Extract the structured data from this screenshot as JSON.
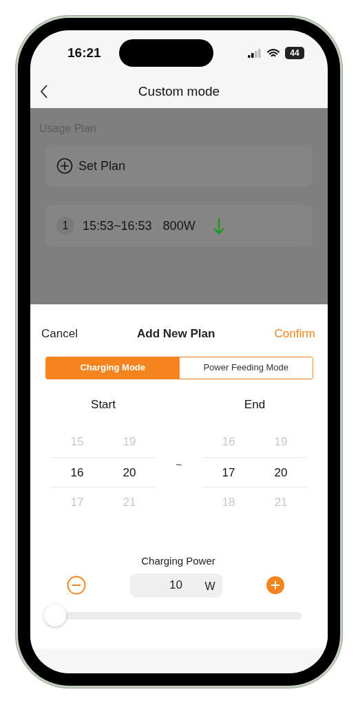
{
  "status_bar": {
    "time": "16:21",
    "battery": "44"
  },
  "nav": {
    "title": "Custom mode"
  },
  "background": {
    "section_title": "Usage Plan",
    "set_plan": "Set Plan",
    "plans": [
      {
        "index": "1",
        "time": "15:53~16:53",
        "power": "800W",
        "kind": "charging"
      }
    ]
  },
  "sheet": {
    "cancel": "Cancel",
    "title": "Add New Plan",
    "confirm": "Confirm",
    "modes": [
      {
        "label": "Charging Mode",
        "selected": true
      },
      {
        "label": "Power Feeding Mode",
        "selected": false
      }
    ],
    "separator": "~",
    "pickers": [
      {
        "label": "Start",
        "columns": [
          [
            {
              "value": "15",
              "selected": false
            },
            {
              "value": "16",
              "selected": true
            },
            {
              "value": "17",
              "selected": false
            }
          ],
          [
            {
              "value": "19",
              "selected": false
            },
            {
              "value": "20",
              "selected": true
            },
            {
              "value": "21",
              "selected": false
            }
          ]
        ]
      },
      {
        "label": "End",
        "columns": [
          [
            {
              "value": "16",
              "selected": false
            },
            {
              "value": "17",
              "selected": true
            },
            {
              "value": "18",
              "selected": false
            }
          ],
          [
            {
              "value": "19",
              "selected": false
            },
            {
              "value": "20",
              "selected": true
            },
            {
              "value": "21",
              "selected": false
            }
          ]
        ]
      }
    ],
    "power_label": "Charging Power",
    "power_value": "10",
    "power_unit": "W",
    "slider": {
      "level": 0
    }
  }
}
